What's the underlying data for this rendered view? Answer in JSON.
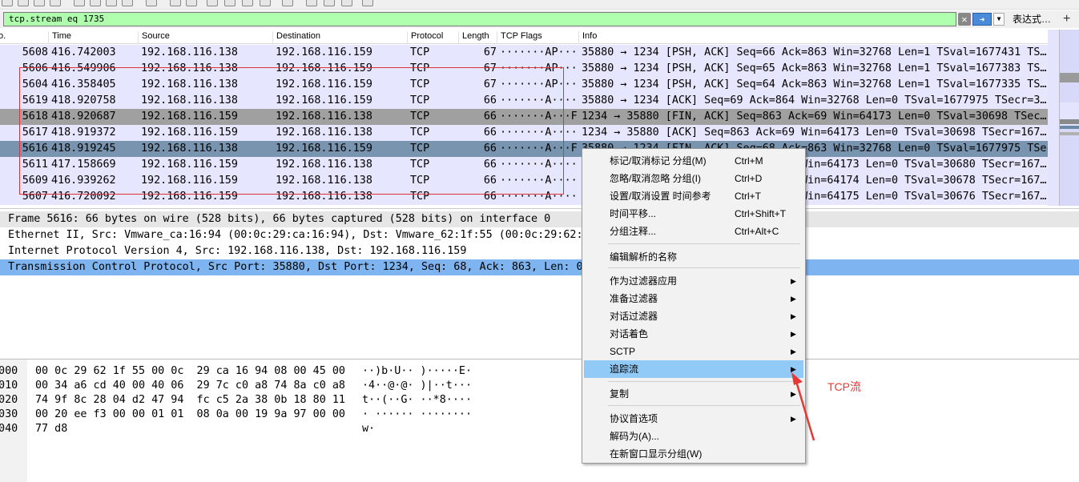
{
  "filter": {
    "value": "tcp.stream eq 1735",
    "clear_glyph": "✕",
    "apply_glyph": "➜",
    "dropdown_glyph": "▼",
    "expression_label": "表达式…",
    "add_glyph": "+"
  },
  "packet_list": {
    "columns": [
      "o.",
      "Time",
      "Source",
      "Destination",
      "Protocol",
      "Length",
      "TCP Flags",
      "Info"
    ],
    "rows": [
      {
        "no": "5608",
        "time": "416.742003",
        "src": "192.168.116.138",
        "dst": "192.168.116.159",
        "proto": "TCP",
        "len": "67",
        "flags": "·······AP···",
        "info": "35880 → 1234 [PSH, ACK] Seq=66 Ack=863 Win=32768 Len=1 TSval=1677431 TS…",
        "style": "tcp"
      },
      {
        "no": "5606",
        "time": "416.549906",
        "src": "192.168.116.138",
        "dst": "192.168.116.159",
        "proto": "TCP",
        "len": "67",
        "flags": "·······AP···",
        "info": "35880 → 1234 [PSH, ACK] Seq=65 Ack=863 Win=32768 Len=1 TSval=1677383 TS…",
        "style": "tcp"
      },
      {
        "no": "5604",
        "time": "416.358405",
        "src": "192.168.116.138",
        "dst": "192.168.116.159",
        "proto": "TCP",
        "len": "67",
        "flags": "·······AP···",
        "info": "35880 → 1234 [PSH, ACK] Seq=64 Ack=863 Win=32768 Len=1 TSval=1677335 TS…",
        "style": "tcp"
      },
      {
        "no": "5619",
        "time": "418.920758",
        "src": "192.168.116.138",
        "dst": "192.168.116.159",
        "proto": "TCP",
        "len": "66",
        "flags": "·······A····",
        "info": "35880 → 1234 [ACK] Seq=69 Ack=864 Win=32768 Len=0 TSval=1677975 TSecr=3…",
        "style": "tcp"
      },
      {
        "no": "5618",
        "time": "418.920687",
        "src": "192.168.116.159",
        "dst": "192.168.116.138",
        "proto": "TCP",
        "len": "66",
        "flags": "·······A···F",
        "info": "1234 → 35880 [FIN, ACK] Seq=863 Ack=69 Win=64173 Len=0 TSval=30698 TSec…",
        "style": "gray"
      },
      {
        "no": "5617",
        "time": "418.919372",
        "src": "192.168.116.159",
        "dst": "192.168.116.138",
        "proto": "TCP",
        "len": "66",
        "flags": "·······A····",
        "info": "1234 → 35880 [ACK] Seq=863 Ack=69 Win=64173 Len=0 TSval=30698 TSecr=167…",
        "style": "tcp"
      },
      {
        "no": "5616",
        "time": "418.919245",
        "src": "192.168.116.138",
        "dst": "192.168.116.159",
        "proto": "TCP",
        "len": "66",
        "flags": "·······A···F",
        "info": "35880 → 1234 [FIN, ACK] Seq=68 Ack=863 Win=32768 Len=0 TSval=1677975 TSec…",
        "style": "sel"
      },
      {
        "no": "5611",
        "time": "417.158669",
        "src": "192.168.116.159",
        "dst": "192.168.116.138",
        "proto": "TCP",
        "len": "66",
        "flags": "·······A····",
        "info": "1234 → 35880 [ACK] Seq=863 Ack=68 Win=64173 Len=0 TSval=30680 TSecr=167…",
        "style": "tcp"
      },
      {
        "no": "5609",
        "time": "416.939262",
        "src": "192.168.116.159",
        "dst": "192.168.116.138",
        "proto": "TCP",
        "len": "66",
        "flags": "·······A····",
        "info": "1234 → 35880 [ACK] Seq=863 Ack=67 Win=64174 Len=0 TSval=30678 TSecr=167…",
        "style": "tcp"
      },
      {
        "no": "5607",
        "time": "416.720092",
        "src": "192.168.116.159",
        "dst": "192.168.116.138",
        "proto": "TCP",
        "len": "66",
        "flags": "·······A····",
        "info": "1234 → 35880 [ACK] Seq=863 Ack=66 Win=64175 Len=0 TSval=30676 TSecr=167…",
        "style": "tcp"
      }
    ]
  },
  "details": {
    "frame": "Frame 5616: 66 bytes on wire (528 bits), 66 bytes captured (528 bits) on interface 0",
    "ethernet": "Ethernet II, Src: Vmware_ca:16:94 (00:0c:29:ca:16:94), Dst: Vmware_62:1f:55 (00:0c:29:62:1",
    "ip": "Internet Protocol Version 4, Src: 192.168.116.138, Dst: 192.168.116.159",
    "tcp": "Transmission Control Protocol, Src Port: 35880, Dst Port: 1234, Seq: 68, Ack: 863, Len: 0"
  },
  "bytes": [
    {
      "offset": "0000",
      "hex": "00 0c 29 62 1f 55 00 0c  29 ca 16 94 08 00 45 00",
      "ascii": "··)b·U·· )·····E·"
    },
    {
      "offset": "0010",
      "hex": "00 34 a6 cd 40 00 40 06  29 7c c0 a8 74 8a c0 a8",
      "ascii": "·4··@·@· )|··t···"
    },
    {
      "offset": "0020",
      "hex": "74 9f 8c 28 04 d2 47 94  fc c5 2a 38 0b 18 80 11",
      "ascii": "t··(··G· ··*8····"
    },
    {
      "offset": "0030",
      "hex": "00 20 ee f3 00 00 01 01  08 0a 00 19 9a 97 00 00",
      "ascii": "· ······ ········"
    },
    {
      "offset": "0040",
      "hex": "77 d8",
      "ascii": "w·"
    }
  ],
  "context_menu": {
    "items": [
      {
        "label": "标记/取消标记 分组(M)",
        "shortcut": "Ctrl+M",
        "arrow": ""
      },
      {
        "label": "忽略/取消忽略 分组(I)",
        "shortcut": "Ctrl+D",
        "arrow": ""
      },
      {
        "label": "设置/取消设置 时间参考",
        "shortcut": "Ctrl+T",
        "arrow": ""
      },
      {
        "label": "时间平移...",
        "shortcut": "Ctrl+Shift+T",
        "arrow": ""
      },
      {
        "label": "分组注释...",
        "shortcut": "Ctrl+Alt+C",
        "arrow": ""
      },
      {
        "label": "编辑解析的名称",
        "shortcut": "",
        "arrow": ""
      },
      {
        "label": "作为过滤器应用",
        "shortcut": "",
        "arrow": "▶"
      },
      {
        "label": "准备过滤器",
        "shortcut": "",
        "arrow": "▶"
      },
      {
        "label": "对话过滤器",
        "shortcut": "",
        "arrow": "▶"
      },
      {
        "label": "对话着色",
        "shortcut": "",
        "arrow": "▶"
      },
      {
        "label": "SCTP",
        "shortcut": "",
        "arrow": "▶"
      },
      {
        "label": "追踪流",
        "shortcut": "",
        "arrow": "▶"
      },
      {
        "label": "复制",
        "shortcut": "",
        "arrow": "▶"
      },
      {
        "label": "协议首选项",
        "shortcut": "",
        "arrow": "▶"
      },
      {
        "label": "解码为(A)...",
        "shortcut": "",
        "arrow": ""
      },
      {
        "label": "在新窗口显示分组(W)",
        "shortcut": "",
        "arrow": ""
      }
    ]
  },
  "annotation": {
    "label": "TCP流"
  },
  "colors": {
    "filter_ok": "#afffaf",
    "tcp_row": "#e7e6ff",
    "selected_row": "#7894ae",
    "fin_row": "#a0a0a0",
    "menu_hover": "#91c9f7",
    "annotation_red": "#e53935"
  }
}
